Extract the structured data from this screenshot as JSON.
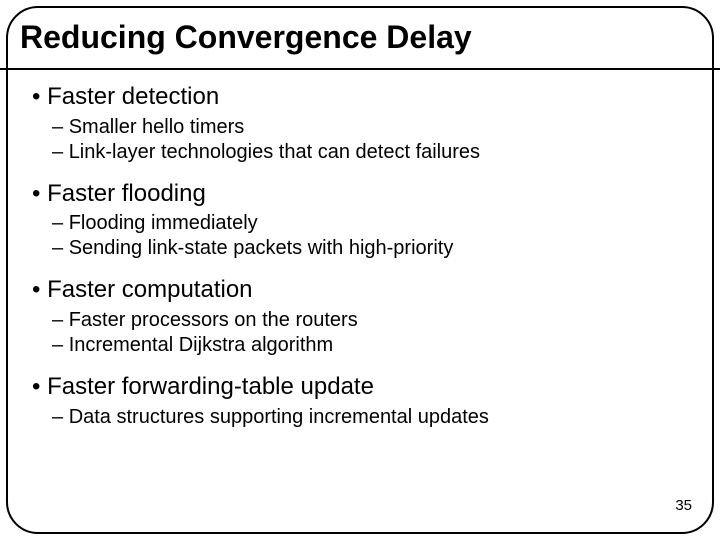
{
  "title": "Reducing Convergence Delay",
  "sections": [
    {
      "heading": "Faster detection",
      "subs": [
        "Smaller hello timers",
        "Link-layer technologies that can detect failures"
      ]
    },
    {
      "heading": "Faster flooding",
      "subs": [
        "Flooding immediately",
        "Sending link-state packets with high-priority"
      ]
    },
    {
      "heading": "Faster computation",
      "subs": [
        "Faster processors on the routers",
        "Incremental Dijkstra algorithm"
      ]
    },
    {
      "heading": "Faster forwarding-table update",
      "subs": [
        "Data structures supporting incremental updates"
      ]
    }
  ],
  "page_number": "35"
}
